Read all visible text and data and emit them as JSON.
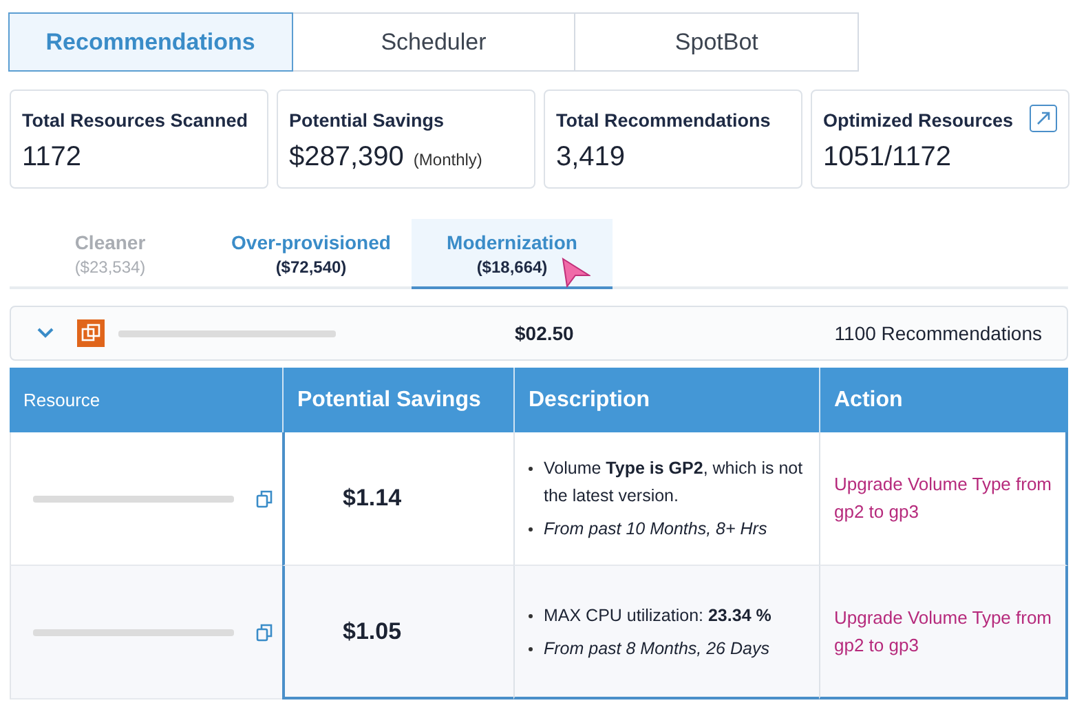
{
  "tabs": [
    {
      "label": "Recommendations",
      "selected": true
    },
    {
      "label": "Scheduler",
      "selected": false
    },
    {
      "label": "SpotBot",
      "selected": false
    }
  ],
  "cards": [
    {
      "title": "Total Resources Scanned",
      "value": "1172",
      "link": false
    },
    {
      "title": "Potential Savings",
      "value": "$287,390",
      "note": "(Monthly)",
      "link": false
    },
    {
      "title": "Total Recommendations",
      "value": "3,419",
      "link": false
    },
    {
      "title": "Optimized Resources",
      "value": "1051/1172",
      "link": true
    }
  ],
  "categories": [
    {
      "label": "Cleaner",
      "amount": "($23,534)",
      "disabled": true,
      "selected": false
    },
    {
      "label": "Over-provisioned",
      "amount": "($72,540)",
      "disabled": false,
      "selected": false
    },
    {
      "label": "Modernization",
      "amount": "($18,664)",
      "disabled": false,
      "selected": true
    }
  ],
  "group": {
    "expanded": true,
    "amount": "$02.50",
    "count": "1100 Recommendations"
  },
  "table": {
    "columns": [
      "Resource",
      "Potential Savings",
      "Description",
      "Action"
    ],
    "rows": [
      {
        "savings": "$1.14",
        "description": [
          {
            "kind": "fact",
            "text": "Volume **Type is GP2**, which is not the latest version."
          },
          {
            "kind": "note",
            "text": "From past 10 Months, 8+ Hrs"
          }
        ],
        "action": "Upgrade Volume Type from gp2 to gp3"
      },
      {
        "savings": "$1.05",
        "description": [
          {
            "kind": "fact",
            "text": "MAX CPU utilization: **23.34 %**"
          },
          {
            "kind": "note",
            "text": "From past 8 Months, 26 Days"
          }
        ],
        "action": "Upgrade Volume Type from gp2 to gp3"
      }
    ]
  }
}
